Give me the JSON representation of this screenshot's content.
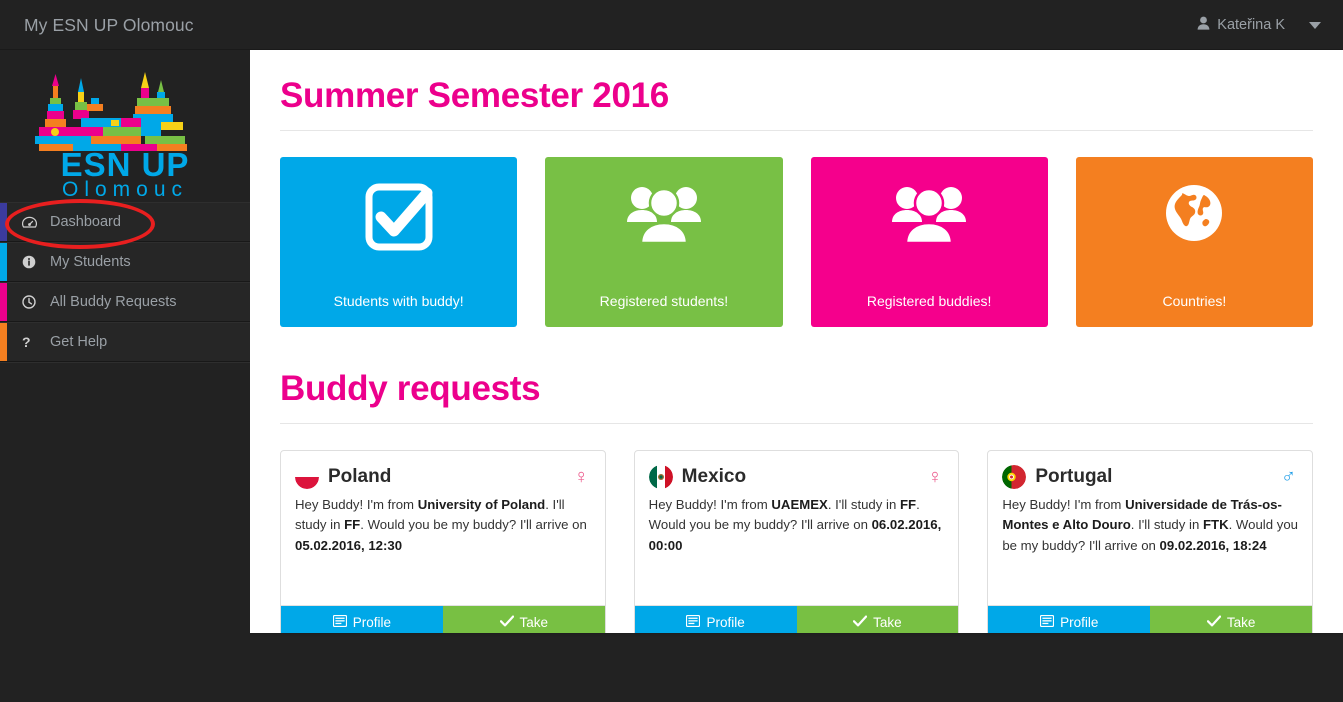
{
  "navbar": {
    "brand": "My ESN UP Olomouc",
    "user_name": "Kateřina K",
    "user_icon": "user-icon",
    "caret_icon": "chevron-down-icon"
  },
  "sidebar": {
    "logo": {
      "title_top": "ESN UP",
      "title_bottom": "Olomouc",
      "logo_color": "#00a8e8"
    },
    "items": [
      {
        "label": "Dashboard",
        "icon": "dashboard-icon",
        "accent": "#3b3b9e",
        "active": true
      },
      {
        "label": "My Students",
        "icon": "info-circle-icon",
        "accent": "#00a8e8",
        "active": false
      },
      {
        "label": "All Buddy Requests",
        "icon": "clock-circle-icon",
        "accent": "#ec008c",
        "active": false
      },
      {
        "label": "Get Help",
        "icon": "question-mark-icon",
        "accent": "#f47f20",
        "active": false
      }
    ]
  },
  "main": {
    "page_title": "Summer Semester 2016",
    "stats": [
      {
        "label": "Students with buddy!",
        "icon": "check-square-icon",
        "color": "#00a8e8"
      },
      {
        "label": "Registered students!",
        "icon": "users-group-icon",
        "color": "#78c045"
      },
      {
        "label": "Registered buddies!",
        "icon": "users-group-icon",
        "color": "#f5008c"
      },
      {
        "label": "Countries!",
        "icon": "globe-icon",
        "color": "#f47f20"
      }
    ],
    "requests_title": "Buddy requests",
    "requests": [
      {
        "country": "Poland",
        "flag": "flag-poland",
        "gender": "female",
        "gender_symbol": "♀",
        "message_parts": [
          {
            "text": "Hey Buddy! I'm from ",
            "bold": false
          },
          {
            "text": "University of Poland",
            "bold": true
          },
          {
            "text": ". I'll study in ",
            "bold": false
          },
          {
            "text": "FF",
            "bold": true
          },
          {
            "text": ". Would you be my buddy? I'll arrive on ",
            "bold": false
          },
          {
            "text": "05.02.2016, 12:30",
            "bold": true
          }
        ],
        "profile_label": "Profile",
        "take_label": "Take"
      },
      {
        "country": "Mexico",
        "flag": "flag-mexico",
        "gender": "female",
        "gender_symbol": "♀",
        "message_parts": [
          {
            "text": "Hey Buddy! I'm from ",
            "bold": false
          },
          {
            "text": "UAEMEX",
            "bold": true
          },
          {
            "text": ". I'll study in ",
            "bold": false
          },
          {
            "text": "FF",
            "bold": true
          },
          {
            "text": ". Would you be my buddy? I'll arrive on ",
            "bold": false
          },
          {
            "text": "06.02.2016, 00:00",
            "bold": true
          }
        ],
        "profile_label": "Profile",
        "take_label": "Take"
      },
      {
        "country": "Portugal",
        "flag": "flag-portugal",
        "gender": "male",
        "gender_symbol": "♂",
        "message_parts": [
          {
            "text": "Hey Buddy! I'm from ",
            "bold": false
          },
          {
            "text": "Universidade de Trás-os-Montes e Alto Douro",
            "bold": true
          },
          {
            "text": ". I'll study in ",
            "bold": false
          },
          {
            "text": "FTK",
            "bold": true
          },
          {
            "text": ". Would you be my buddy? I'll arrive on ",
            "bold": false
          },
          {
            "text": "09.02.2016, 18:24",
            "bold": true
          }
        ],
        "profile_label": "Profile",
        "take_label": "Take"
      }
    ]
  },
  "annotation": {
    "shape": "oval",
    "color": "#e81f1f",
    "target": "Dashboard"
  }
}
